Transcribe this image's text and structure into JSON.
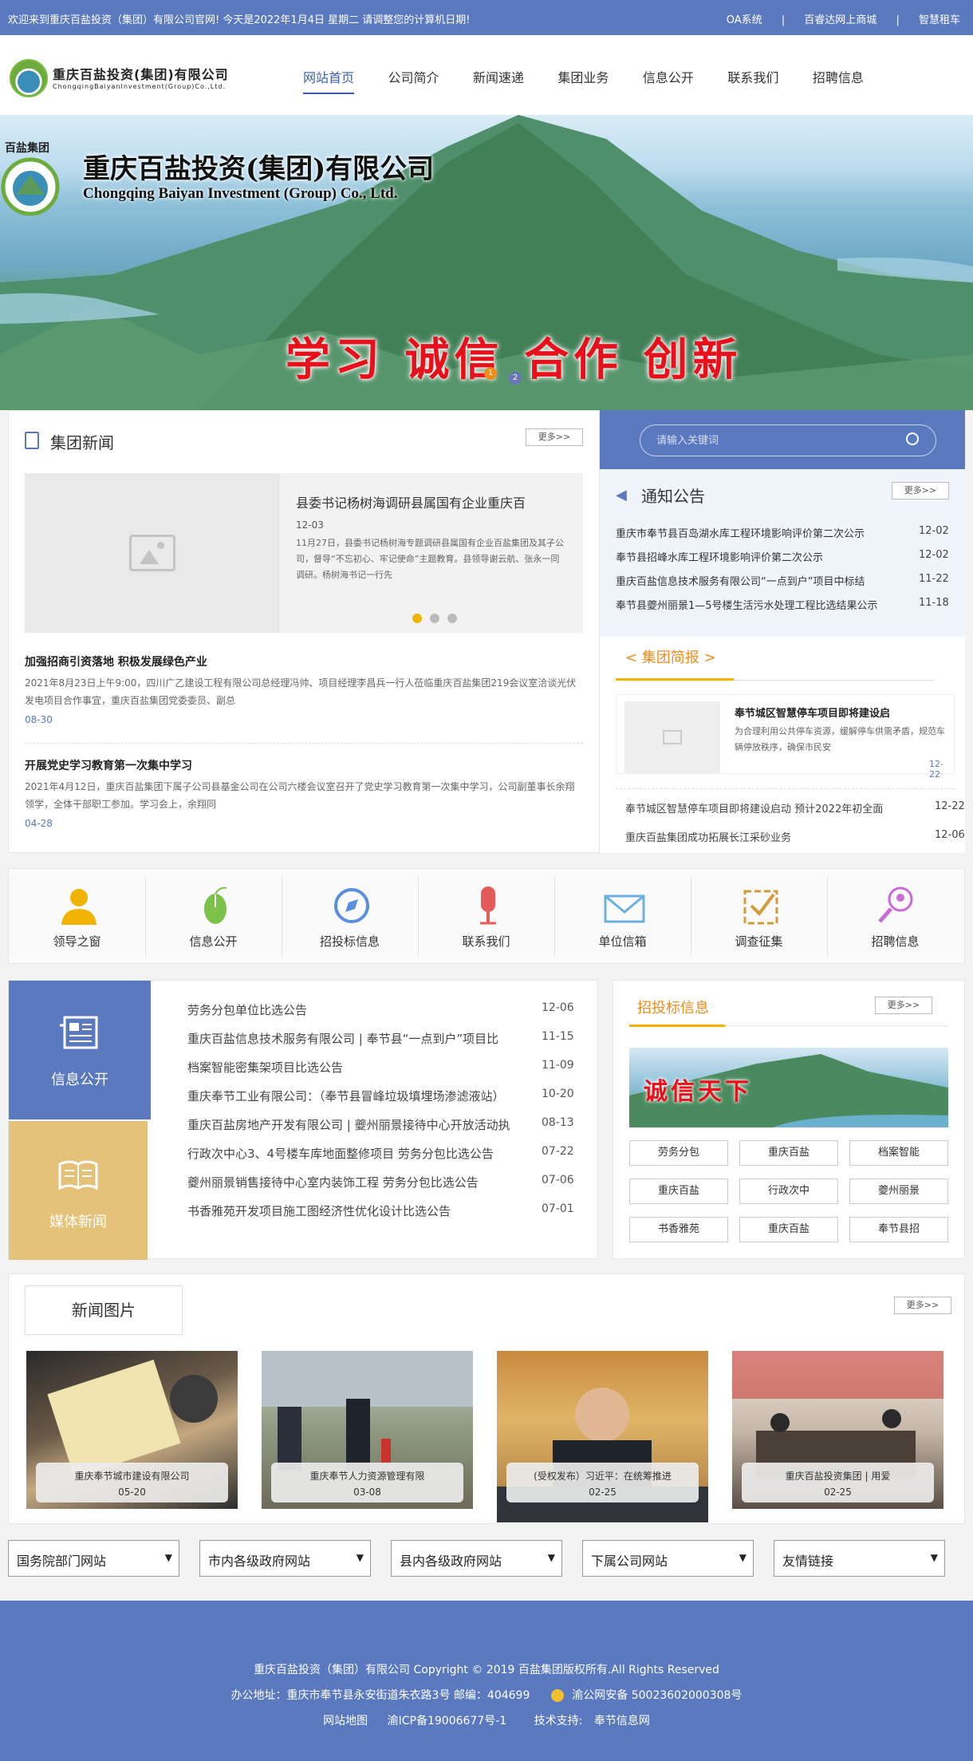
{
  "topbar": {
    "welcome": "欢迎来到重庆百盐投资（集团）有限公司官网! 今天是2022年1月4日 星期二     请调整您的计算机日期!",
    "links": [
      "OA系统",
      "|",
      "百睿达网上商城",
      "|",
      "智慧租车"
    ]
  },
  "header": {
    "logo_cn": "重庆百盐投资(集团)有限公司",
    "logo_en": "ChongqingBaiyanInvestment(Group)Co.,Ltd.",
    "nav": [
      "网站首页",
      "公司简介",
      "新闻速递",
      "集团业务",
      "信息公开",
      "联系我们",
      "招聘信息"
    ]
  },
  "banner": {
    "logo_text": "百盐集团",
    "title": "重庆百盐投资(集团)有限公司",
    "title_en": "Chongqing Baiyan Investment (Group) Co., Ltd.",
    "slogan": "学习 诚信 合作 创新",
    "dots": [
      "1",
      "2"
    ]
  },
  "group_news": {
    "title": "集团新闻",
    "more": "更多>>",
    "featured": {
      "title": "县委书记杨树海调研县属国有企业重庆百",
      "date": "12-03",
      "desc": "11月27日，县委书记杨树海专题调研县属国有企业百盐集团及其子公司，督导“不忘初心、牢记使命”主题教育。县领导谢云航、张永一同调研。杨树海书记一行先"
    },
    "items": [
      {
        "title": "加强招商引资落地 积极发展绿色产业",
        "desc": "2021年8月23日上午9:00，四川广乙建设工程有限公司总经理冯帅、项目经理李昌兵一行人莅临重庆百盐集团219会议室洽谈光伏发电项目合作事宜，重庆百盐集团党委委员、副总",
        "date": "08-30"
      },
      {
        "title": "开展党史学习教育第一次集中学习",
        "desc": "2021年4月12日，重庆百盐集团下属子公司县基金公司在公司六楼会议室召开了党史学习教育第一次集中学习，公司副董事长余翔领学，全体干部职工参加。学习会上，余翔同",
        "date": "04-28"
      }
    ]
  },
  "search": {
    "placeholder": "请输入关键词"
  },
  "notice": {
    "title": "通知公告",
    "more": "更多>>",
    "items": [
      {
        "text": "重庆市奉节县百岛湖水库工程环境影响评价第二次公示",
        "date": "12-02"
      },
      {
        "text": "奉节县招峰水库工程环境影响评价第二次公示",
        "date": "12-02"
      },
      {
        "text": "重庆百盐信息技术服务有限公司“一点到户”项目中标结",
        "date": "11-22"
      },
      {
        "text": "奉节县夔州丽景1—5号楼生活污水处理工程比选结果公示",
        "date": "11-18"
      }
    ]
  },
  "briefing": {
    "title": "< 集团简报 >",
    "featured": {
      "title": "奉节城区智慧停车项目即将建设启",
      "desc": "为合理利用公共停车资源，缓解停车供需矛盾，规范车辆停放秩序，确保市民安",
      "date": "12-22"
    },
    "items": [
      {
        "text": "奉节城区智慧停车项目即将建设启动 预计2022年初全面",
        "date": "12-22"
      },
      {
        "text": "重庆百盐集团成功拓展长江采砂业务",
        "date": "12-06"
      }
    ]
  },
  "quick_links": [
    {
      "label": "领导之窗",
      "icon": "leader-icon"
    },
    {
      "label": "信息公开",
      "icon": "mouse-icon"
    },
    {
      "label": "招投标信息",
      "icon": "compass-icon"
    },
    {
      "label": "联系我们",
      "icon": "microphone-icon"
    },
    {
      "label": "单位信箱",
      "icon": "mail-icon"
    },
    {
      "label": "调查征集",
      "icon": "checklist-icon"
    },
    {
      "label": "招聘信息",
      "icon": "search-person-icon"
    }
  ],
  "info_tabs": [
    {
      "label": "信息公开",
      "color": "#5a79bf"
    },
    {
      "label": "媒体新闻",
      "color": "#e4c27a"
    }
  ],
  "info_list": [
    {
      "text": "劳务分包单位比选公告",
      "date": "12-06"
    },
    {
      "text": "重庆百盐信息技术服务有限公司 | 奉节县“一点到户”项目比",
      "date": "11-15"
    },
    {
      "text": "档案智能密集架项目比选公告",
      "date": "11-09"
    },
    {
      "text": "重庆奉节工业有限公司：（奉节县冒峰垃圾填埋场渗滤液站）",
      "date": "10-20"
    },
    {
      "text": "重庆百盐房地产开发有限公司 | 夔州丽景接待中心开放活动执",
      "date": "08-13"
    },
    {
      "text": "行政次中心3、4号楼车库地面整修项目 劳务分包比选公告",
      "date": "07-22"
    },
    {
      "text": "夔州丽景销售接待中心室内装饰工程 劳务分包比选公告",
      "date": "07-06"
    },
    {
      "text": "书香雅苑开发项目施工图经济性优化设计比选公告",
      "date": "07-01"
    }
  ],
  "bidding": {
    "title": "招投标信息",
    "more": "更多>>",
    "banner_text": "诚信天下",
    "tags": [
      "劳务分包",
      "重庆百盐",
      "档案智能",
      "重庆百盐",
      "行政次中",
      "夔州丽景",
      "书香雅苑",
      "重庆百盐",
      "奉节县招"
    ]
  },
  "news_pictures": {
    "title": "新闻图片",
    "more": "更多>>",
    "items": [
      {
        "caption": "重庆奉节城市建设有限公司",
        "date": "05-20"
      },
      {
        "caption": "重庆奉节人力资源管理有限",
        "date": "03-08"
      },
      {
        "caption": "(受权发布）习近平：在统筹推进",
        "date": "02-25"
      },
      {
        "caption": "重庆百盐投资集团 | 用爱",
        "date": "02-25"
      }
    ]
  },
  "selects": [
    "国务院部门网站",
    "市内各级政府网站",
    "县内各级政府网站",
    "下属公司网站",
    "友情链接"
  ],
  "footer": {
    "line1": "重庆百盐投资（集团）有限公司    Copyright © 2019 百盐集团版权所有.All Rights Reserved",
    "address": "办公地址：重庆市奉节县永安街道朱衣路3号 邮编：404699",
    "police": "渝公网安备 50023602000308号",
    "sitemap": "网站地图",
    "icp": "渝ICP备19006677号-1",
    "support_label": "技术支持:",
    "support": "奉节信息网"
  }
}
